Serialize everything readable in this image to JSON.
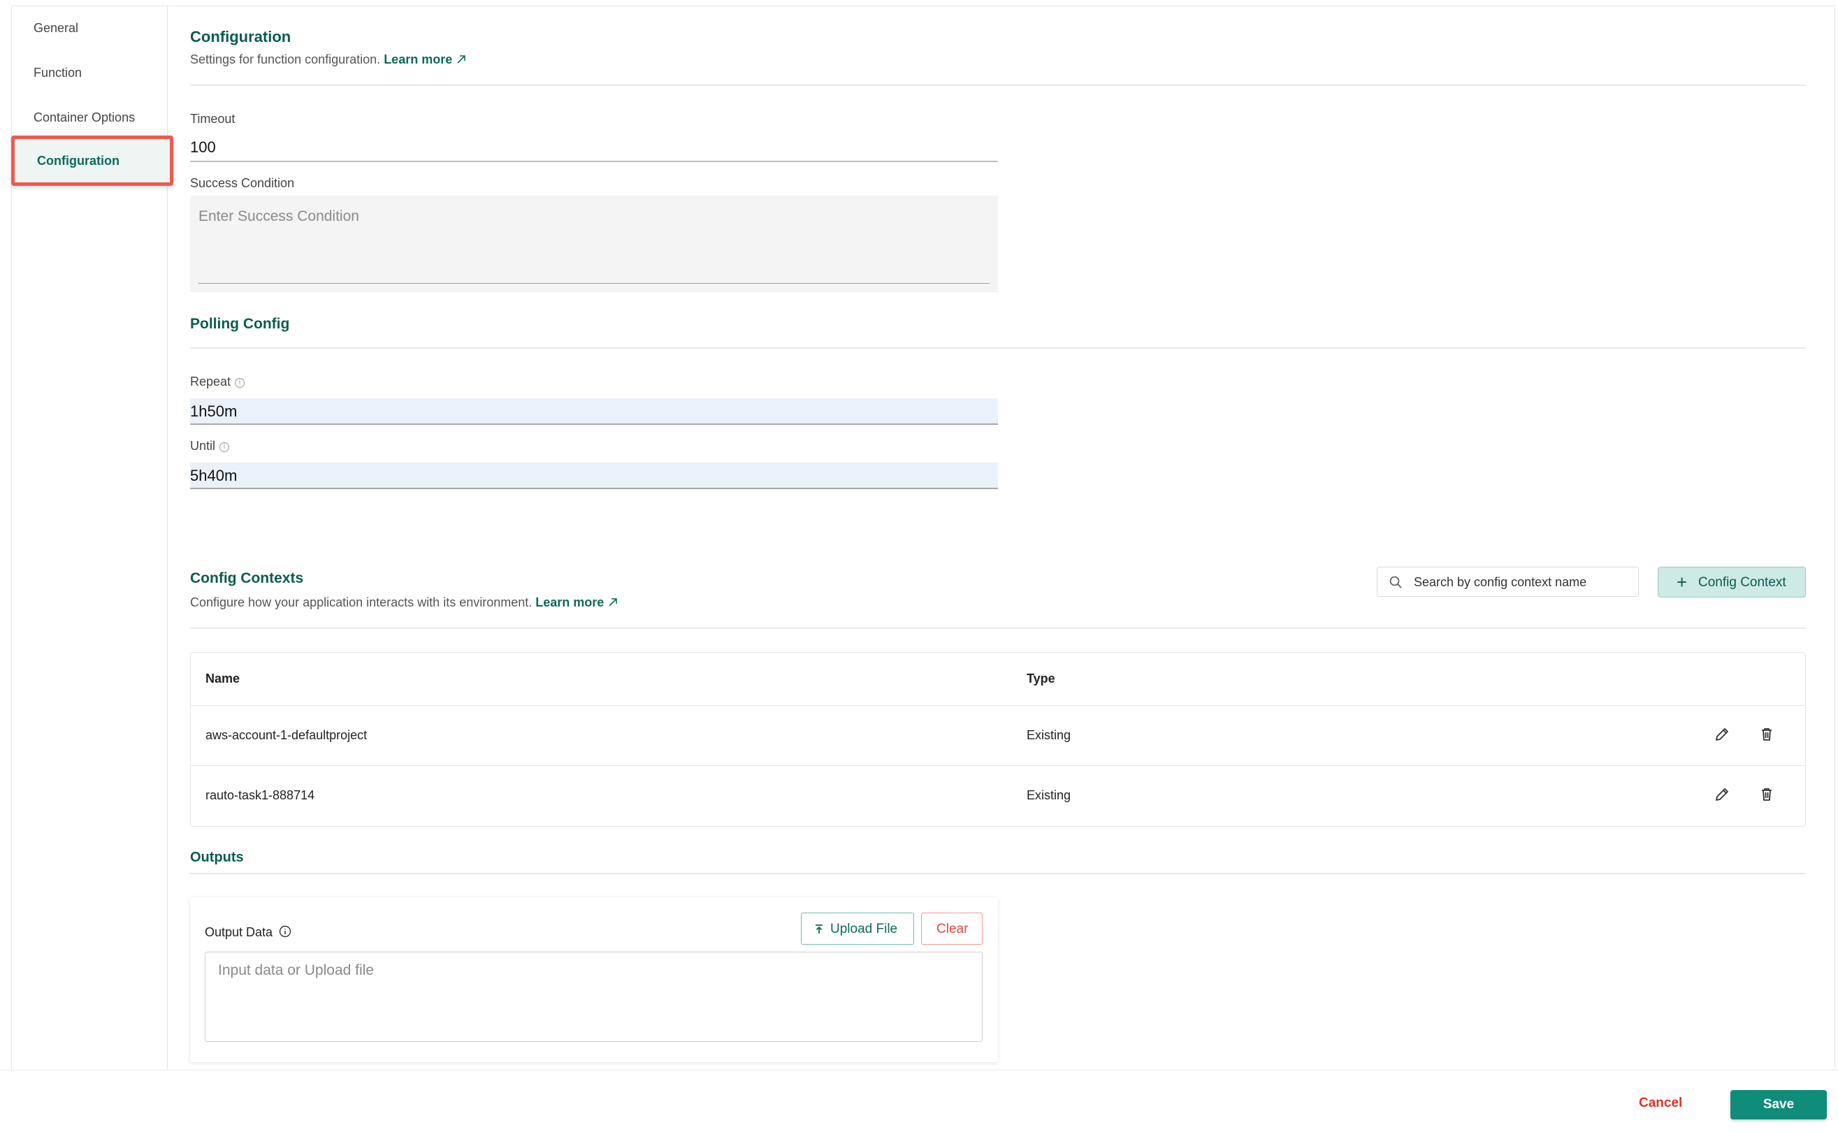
{
  "sidebar": {
    "items": [
      {
        "label": "General"
      },
      {
        "label": "Function"
      },
      {
        "label": "Container Options"
      },
      {
        "label": "Configuration"
      }
    ]
  },
  "configuration": {
    "title": "Configuration",
    "description": "Settings for function configuration.",
    "learn_more": "Learn more",
    "timeout_label": "Timeout",
    "timeout_value": "100",
    "success_label": "Success Condition",
    "success_placeholder": "Enter Success Condition"
  },
  "polling": {
    "title": "Polling Config",
    "repeat_label": "Repeat",
    "repeat_value": "1h50m",
    "until_label": "Until",
    "until_value": "5h40m"
  },
  "contexts": {
    "title": "Config Contexts",
    "description": "Configure how your application interacts with its environment.",
    "learn_more": "Learn more",
    "search_placeholder": "Search by config context name",
    "add_button": "Config Context",
    "columns": [
      "Name",
      "Type"
    ],
    "rows": [
      {
        "name": "aws-account-1-defaultproject",
        "type": "Existing"
      },
      {
        "name": "rauto-task1-888714",
        "type": "Existing"
      }
    ]
  },
  "outputs": {
    "title": "Outputs",
    "data_label": "Output Data",
    "upload_label": "Upload File",
    "clear_label": "Clear",
    "placeholder": "Input data or Upload file"
  },
  "footer": {
    "cancel": "Cancel",
    "save": "Save"
  },
  "colors": {
    "accent": "#0f8c7a",
    "heading": "#0b5c4f",
    "highlight_border": "#ef5a4d",
    "danger": "#e0322a"
  }
}
